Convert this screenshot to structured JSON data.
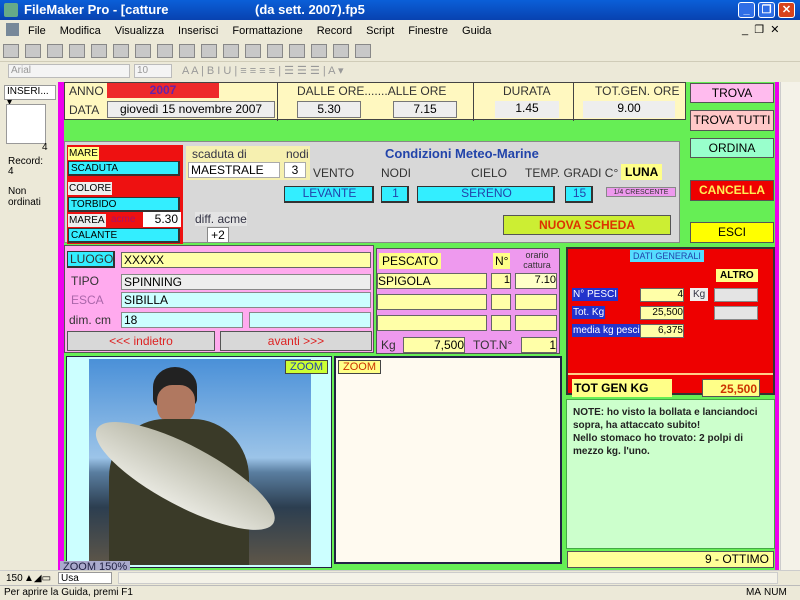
{
  "window": {
    "title": "FileMaker Pro - [catture",
    "title_right": "(da sett. 2007).fp5"
  },
  "menu": [
    "File",
    "Modifica",
    "Visualizza",
    "Inserisci",
    "Formattazione",
    "Record",
    "Script",
    "Finestre",
    "Guida"
  ],
  "format_bar": {
    "font": "Arial",
    "size": "10"
  },
  "side": {
    "mode": "INSERI...",
    "record_count": "4",
    "record_label": "Record:",
    "record_value": "4",
    "sort": "Non ordinati"
  },
  "header": {
    "anno_label": "ANNO",
    "anno": "2007",
    "data_label": "DATA",
    "data": "giovedì 15 novembre 2007",
    "dalle_label": "DALLE ORE.......ALLE ORE",
    "dalle": "5.30",
    "alle": "7.15",
    "durata_label": "DURATA",
    "durata": "1.45",
    "tot_label": "TOT.GEN. ORE",
    "tot": "9.00"
  },
  "buttons": {
    "trova": "TROVA",
    "trova_tutti": "TROVA TUTTI",
    "ordina": "ORDINA",
    "cancella": "CANCELLA",
    "esci": "ESCI",
    "nuova": "NUOVA SCHEDA"
  },
  "meteo": {
    "title": "Condizioni Meteo-Marine",
    "mare": "MARE",
    "mare_val": "SCADUTA",
    "colore": "COLORE",
    "colore_val": "TORBIDO",
    "marea": "MAREA",
    "acme": "acme",
    "acme_val": "5.30",
    "marea_val": "CALANTE",
    "scaduta_di": "scaduta di",
    "nodi_lbl": "nodi",
    "scaduta_val": "MAESTRALE",
    "nodi_val": "3",
    "vento": "VENTO",
    "vento_val": "LEVANTE",
    "nodi2": "NODI",
    "nodi2_val": "1",
    "cielo": "CIELO",
    "cielo_val": "SERENO",
    "temp": "TEMP. GRADI C°",
    "temp_val": "15",
    "luna": "LUNA",
    "luna_val": "1/4 CRESCENTE",
    "diff": "diff. acme",
    "diff_val": "+2"
  },
  "luogo": {
    "luogo_lbl": "LUOGO",
    "luogo": "XXXXX",
    "tipo_lbl": "TIPO",
    "tipo": "SPINNING",
    "esca_lbl": "ESCA",
    "esca": "SIBILLA",
    "dim_lbl": "dim. cm",
    "dim": "18",
    "prev": "<<<    indietro",
    "next": "avanti    >>>"
  },
  "pescato": {
    "label": "PESCATO",
    "n_label": "N°",
    "orario_label": "orario cattura",
    "rows": [
      {
        "specie": "SPIGOLA",
        "n": "1",
        "orario": "7.10"
      },
      {
        "specie": "",
        "n": "",
        "orario": ""
      },
      {
        "specie": "",
        "n": "",
        "orario": ""
      }
    ],
    "kg_label": "Kg",
    "kg": "7,500",
    "totn_label": "TOT.N°",
    "totn": "1"
  },
  "dati": {
    "title": "DATI GENERALI",
    "altro": "ALTRO",
    "npesci_lbl": "N° PESCI",
    "npesci": "4",
    "kg_lbl": "Kg",
    "totkg_lbl": "Tot. Kg",
    "totkg": "25,500",
    "media_lbl": "media kg pesci",
    "media": "6,375",
    "totgen_lbl": "TOT GEN KG",
    "totgen": "25,500"
  },
  "photo": {
    "zoom1": "ZOOM",
    "zoom2": "ZOOM",
    "zoom150": "ZOOM 150%"
  },
  "note": "NOTE: ho visto la bollata e lanciandoci sopra, ha attaccato subito!\nNello stomaco ho trovato: 2 polpi di mezzo kg. l'uno.",
  "rating": "9 - OTTIMO",
  "bottom": {
    "zoom": "150",
    "view": "Usa"
  },
  "status": {
    "text": "Per aprire la Guida, premi F1",
    "caps": "MA",
    "num": "NUM"
  }
}
